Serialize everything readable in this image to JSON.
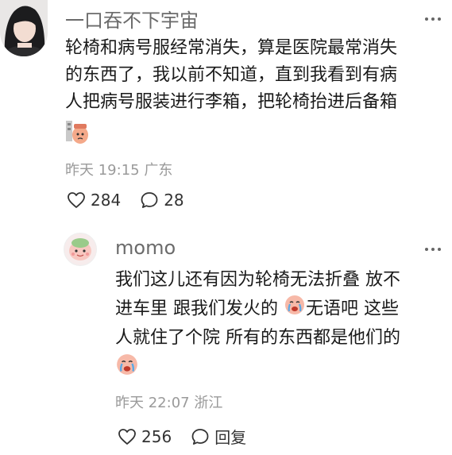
{
  "comment": {
    "username": "一口吞不下宇宙",
    "lines": [
      "轮椅和病号服经常消失，算是医院最常消失",
      "的东西了，我以前不知道，直到我看到有病",
      "人把病号服装进行李箱，把轮椅抬进后备箱"
    ],
    "emoji": "sticker-emoji",
    "meta": "昨天 19:15 广东",
    "likes": "284",
    "replies": "28"
  },
  "reply": {
    "username": "momo",
    "line1": "我们这儿还有因为轮椅无法折叠 放不",
    "line2a": "进车里 跟我们发火的 ",
    "line2b": "无语吧 这些",
    "line3": "人就住了个院 所有的东西都是他们的",
    "meta": "昨天 22:07 浙江",
    "likes": "256",
    "reply_label": "回复"
  },
  "icons": [
    "more-icon",
    "heart-icon",
    "comment-icon",
    "crying-face-emoji"
  ]
}
